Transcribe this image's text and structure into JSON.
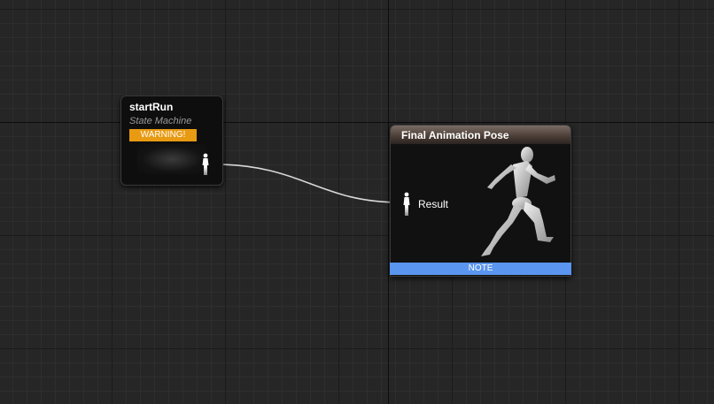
{
  "nodes": {
    "state_machine": {
      "title": "startRun",
      "subtitle": "State Machine",
      "warning": "WARNING!"
    },
    "final_pose": {
      "title": "Final Animation Pose",
      "pin_label": "Result",
      "note": "NOTE"
    }
  },
  "icons": {
    "pose_pin": "pose-pin-icon",
    "mannequin": "running-mannequin-icon"
  },
  "colors": {
    "warning": "#e89a12",
    "note": "#5a95ef",
    "wire": "#d8d8d8"
  }
}
